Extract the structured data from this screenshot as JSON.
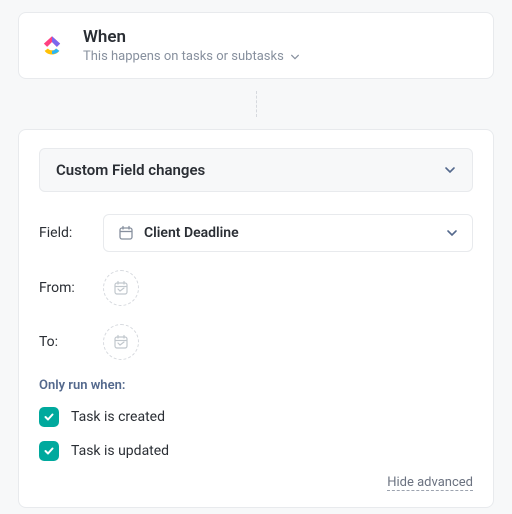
{
  "header": {
    "title": "When",
    "subtitle": "This happens on tasks or subtasks"
  },
  "trigger": {
    "label": "Custom Field changes"
  },
  "field": {
    "label": "Field:",
    "value": "Client Deadline"
  },
  "from": {
    "label": "From:"
  },
  "to": {
    "label": "To:"
  },
  "only_run_label": "Only run when:",
  "checks": [
    {
      "label": "Task is created",
      "checked": true
    },
    {
      "label": "Task is updated",
      "checked": true
    }
  ],
  "footer": {
    "hide_advanced": "Hide advanced"
  }
}
